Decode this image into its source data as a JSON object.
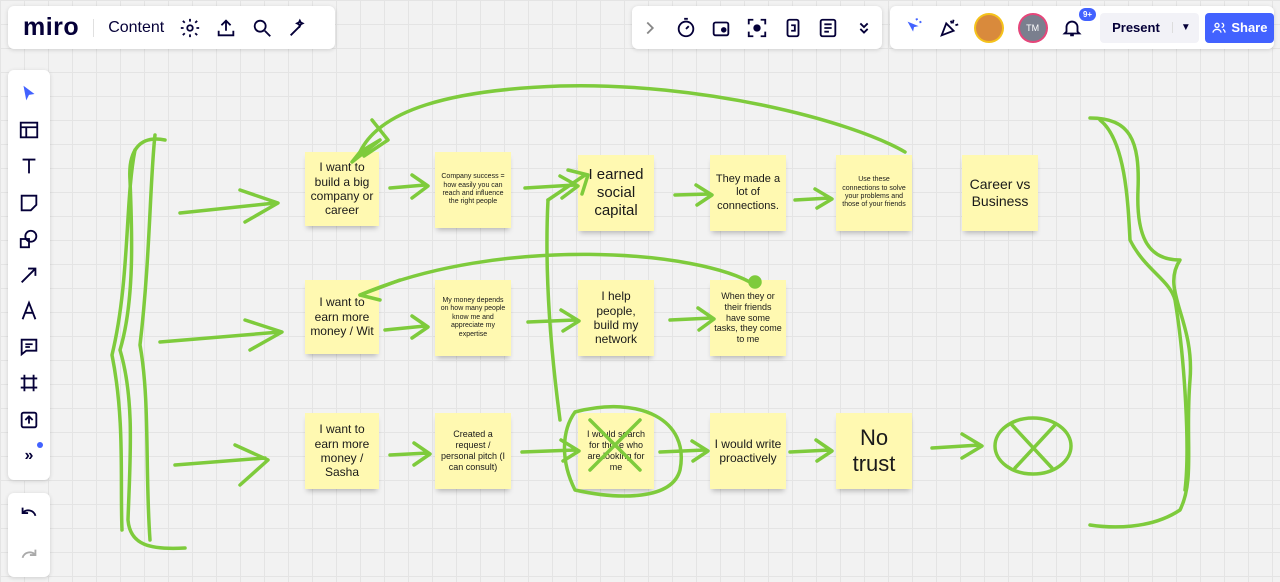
{
  "app": {
    "logo": "miro",
    "board_name": "Content"
  },
  "topbar_left_icons": [
    "gear-icon",
    "upload-icon",
    "search-icon",
    "magic-wand-icon"
  ],
  "topbar_mid_icons": [
    "chevron-right-icon",
    "timer-icon",
    "voting-icon",
    "capture-icon",
    "card-icon",
    "notes-icon",
    "double-chevron-down-icon"
  ],
  "collab": {
    "notification_badge": "9+",
    "avatar2_initials": "TM",
    "present_label": "Present",
    "share_label": "Share"
  },
  "tools": [
    "select-icon",
    "table-icon",
    "text-icon",
    "sticky-note-icon",
    "shapes-icon",
    "arrow-icon",
    "pen-icon",
    "comment-icon",
    "frame-icon",
    "upload-icon",
    "more-tools-icon"
  ],
  "stickies": [
    {
      "text": "I want to build a big company or career"
    },
    {
      "text": "Company success = how easily you can reach and influence the right people"
    },
    {
      "text": "I earned social capital"
    },
    {
      "text": "They made a lot of connections."
    },
    {
      "text": "Use these connections to solve your problems and those of your friends"
    },
    {
      "text": "Career vs Business"
    },
    {
      "text": "I want to earn more money / Wit"
    },
    {
      "text": "My money depends on how many people know me and appreciate my expertise"
    },
    {
      "text": "I help people, build my network"
    },
    {
      "text": "When they or their friends have some tasks, they come to me"
    },
    {
      "text": "I want to earn more money / Sasha"
    },
    {
      "text": "Created a request / personal pitch (I can consult)"
    },
    {
      "text": "I would search for those who are looking for me"
    },
    {
      "text": "I would write proactively"
    },
    {
      "text": "No trust"
    }
  ],
  "colors": {
    "accent": "#4262ff",
    "sticky": "#fff9b1",
    "drawing": "#7ecb3c"
  }
}
